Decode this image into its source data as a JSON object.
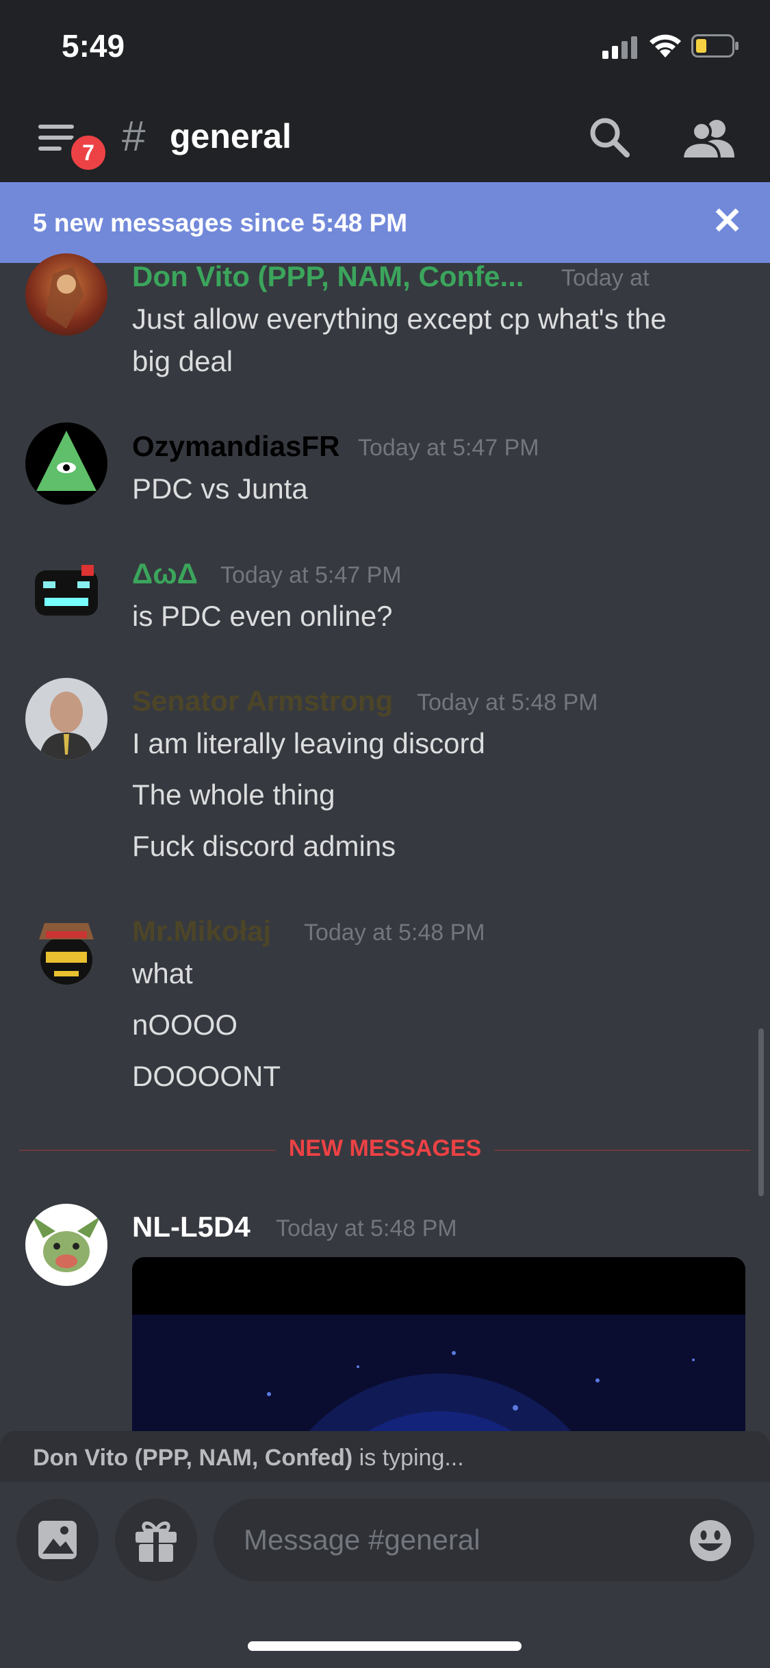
{
  "status_bar": {
    "time": "5:49"
  },
  "header": {
    "unread_badge": "7",
    "channel_name": "general"
  },
  "new_messages_bar": {
    "text": "5 new messages since 5:48 PM"
  },
  "messages": [
    {
      "author": "Don Vito (PPP, NAM, Confe...",
      "author_color": "#3ba55c",
      "timestamp": "Today at",
      "lines": [
        "Just allow everything except cp what's the",
        "big deal"
      ]
    },
    {
      "author": "OzymandiasFR",
      "author_color": "#000000",
      "timestamp": "Today at 5:47 PM",
      "lines": [
        "PDC vs Junta"
      ]
    },
    {
      "author": "ΔωΔ",
      "author_color": "#3ba55c",
      "timestamp": "Today at 5:47 PM",
      "lines": [
        "is PDC even online?"
      ]
    },
    {
      "author": "Senator Armstrong",
      "author_color": "#4d4527",
      "timestamp": "Today at 5:48 PM",
      "lines": [
        "I am literally leaving discord",
        "The whole thing",
        "Fuck discord admins"
      ]
    },
    {
      "author": "Mr.Mikołaj",
      "author_color": "#4d4527",
      "timestamp": "Today at 5:48 PM",
      "lines": [
        "what",
        "nOOOO",
        "DOOOONT"
      ]
    },
    {
      "author": "NL-L5D4",
      "author_color": "#ffffff",
      "timestamp": "Today at 5:48 PM",
      "lines": []
    }
  ],
  "divider_label": "NEW MESSAGES",
  "typing": {
    "user": "Don Vito (PPP, NAM, Confed)",
    "suffix": " is typing..."
  },
  "composer": {
    "placeholder": "Message #general"
  },
  "icons": {
    "menu": "hamburger-menu-icon",
    "search": "search-icon",
    "members": "members-icon",
    "close": "close-icon",
    "image": "image-icon",
    "gift": "gift-icon",
    "emoji": "emoji-icon"
  },
  "colors": {
    "blurple": "#7289da",
    "danger": "#ed4245",
    "background": "#36393f",
    "header": "#202225"
  }
}
